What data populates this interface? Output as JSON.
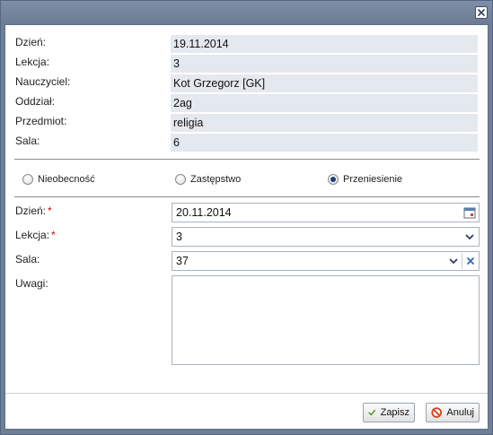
{
  "dialog": {
    "close_icon": "close-icon"
  },
  "info": [
    {
      "label": "Dzień:",
      "value": "19.11.2014"
    },
    {
      "label": "Lekcja:",
      "value": "3"
    },
    {
      "label": "Nauczyciel:",
      "value": "Kot Grzegorz [GK]"
    },
    {
      "label": "Oddział:",
      "value": "2ag"
    },
    {
      "label": "Przedmiot:",
      "value": "religia"
    },
    {
      "label": "Sala:",
      "value": "6"
    }
  ],
  "options": [
    {
      "label": "Nieobecność",
      "checked": false
    },
    {
      "label": "Zastępstwo",
      "checked": false
    },
    {
      "label": "Przeniesienie",
      "checked": true
    }
  ],
  "form": {
    "day_label": "Dzień:",
    "day_value": "20.11.2014",
    "lesson_label": "Lekcja:",
    "lesson_value": "3",
    "room_label": "Sala:",
    "room_value": "37",
    "notes_label": "Uwagi:",
    "notes_value": "",
    "required_mark": "*"
  },
  "buttons": {
    "save_label": "Zapisz",
    "cancel_label": "Anuluj"
  },
  "colors": {
    "frame": "#6e7f97",
    "readonly_bg": "#e4e8ef",
    "required": "#d00000",
    "save_icon": "#5aa02c",
    "cancel_icon": "#d9441c"
  }
}
